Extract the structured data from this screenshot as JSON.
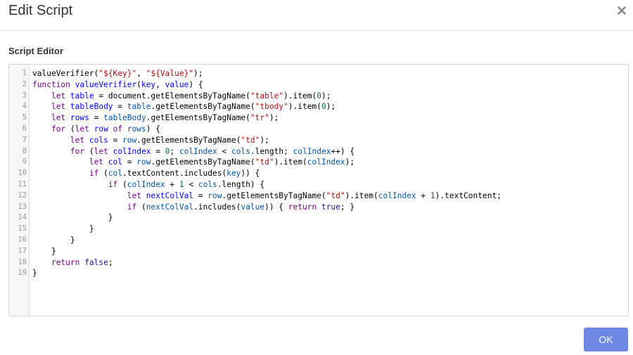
{
  "dialog": {
    "title": "Edit Script",
    "close_icon": "close-icon"
  },
  "editor": {
    "label": "Script Editor",
    "lines": [
      [
        [
          "plain",
          "valueVerifier("
        ],
        [
          "str",
          "\"${Key}\""
        ],
        [
          "plain",
          ", "
        ],
        [
          "str",
          "\"${Value}\""
        ],
        [
          "plain",
          ");"
        ]
      ],
      [
        [
          "kw",
          "function"
        ],
        [
          "plain",
          " "
        ],
        [
          "def",
          "valueVerifier"
        ],
        [
          "plain",
          "("
        ],
        [
          "def",
          "key"
        ],
        [
          "plain",
          ", "
        ],
        [
          "def",
          "value"
        ],
        [
          "plain",
          ") {"
        ]
      ],
      [
        [
          "plain",
          "    "
        ],
        [
          "kw",
          "let"
        ],
        [
          "plain",
          " "
        ],
        [
          "def",
          "table"
        ],
        [
          "plain",
          " = document.getElementsByTagName("
        ],
        [
          "str",
          "\"table\""
        ],
        [
          "plain",
          ").item("
        ],
        [
          "num",
          "0"
        ],
        [
          "plain",
          ");"
        ]
      ],
      [
        [
          "plain",
          "    "
        ],
        [
          "kw",
          "let"
        ],
        [
          "plain",
          " "
        ],
        [
          "def",
          "tableBody"
        ],
        [
          "plain",
          " = "
        ],
        [
          "var2",
          "table"
        ],
        [
          "plain",
          ".getElementsByTagName("
        ],
        [
          "str",
          "\"tbody\""
        ],
        [
          "plain",
          ").item("
        ],
        [
          "num",
          "0"
        ],
        [
          "plain",
          ");"
        ]
      ],
      [
        [
          "plain",
          "    "
        ],
        [
          "kw",
          "let"
        ],
        [
          "plain",
          " "
        ],
        [
          "def",
          "rows"
        ],
        [
          "plain",
          " = "
        ],
        [
          "var2",
          "tableBody"
        ],
        [
          "plain",
          ".getElementsByTagName("
        ],
        [
          "str",
          "\"tr\""
        ],
        [
          "plain",
          ");"
        ]
      ],
      [
        [
          "plain",
          "    "
        ],
        [
          "kw",
          "for"
        ],
        [
          "plain",
          " ("
        ],
        [
          "kw",
          "let"
        ],
        [
          "plain",
          " "
        ],
        [
          "def",
          "row"
        ],
        [
          "plain",
          " "
        ],
        [
          "kw",
          "of"
        ],
        [
          "plain",
          " "
        ],
        [
          "var2",
          "rows"
        ],
        [
          "plain",
          ") {"
        ]
      ],
      [
        [
          "plain",
          "        "
        ],
        [
          "kw",
          "let"
        ],
        [
          "plain",
          " "
        ],
        [
          "def",
          "cols"
        ],
        [
          "plain",
          " = "
        ],
        [
          "var2",
          "row"
        ],
        [
          "plain",
          ".getElementsByTagName("
        ],
        [
          "str",
          "\"td\""
        ],
        [
          "plain",
          ");"
        ]
      ],
      [
        [
          "plain",
          "        "
        ],
        [
          "kw",
          "for"
        ],
        [
          "plain",
          " ("
        ],
        [
          "kw",
          "let"
        ],
        [
          "plain",
          " "
        ],
        [
          "def",
          "colIndex"
        ],
        [
          "plain",
          " = "
        ],
        [
          "num",
          "0"
        ],
        [
          "plain",
          "; "
        ],
        [
          "var2",
          "colIndex"
        ],
        [
          "plain",
          " < "
        ],
        [
          "var2",
          "cols"
        ],
        [
          "plain",
          ".length; "
        ],
        [
          "var2",
          "colIndex"
        ],
        [
          "plain",
          "++) {"
        ]
      ],
      [
        [
          "plain",
          "            "
        ],
        [
          "kw",
          "let"
        ],
        [
          "plain",
          " "
        ],
        [
          "def",
          "col"
        ],
        [
          "plain",
          " = "
        ],
        [
          "var2",
          "row"
        ],
        [
          "plain",
          ".getElementsByTagName("
        ],
        [
          "str",
          "\"td\""
        ],
        [
          "plain",
          ").item("
        ],
        [
          "var2",
          "colIndex"
        ],
        [
          "plain",
          ");"
        ]
      ],
      [
        [
          "plain",
          "            "
        ],
        [
          "kw",
          "if"
        ],
        [
          "plain",
          " ("
        ],
        [
          "var2",
          "col"
        ],
        [
          "plain",
          ".textContent.includes("
        ],
        [
          "var2",
          "key"
        ],
        [
          "plain",
          ")) {"
        ]
      ],
      [
        [
          "plain",
          "                "
        ],
        [
          "kw",
          "if"
        ],
        [
          "plain",
          " ("
        ],
        [
          "var2",
          "colIndex"
        ],
        [
          "plain",
          " + "
        ],
        [
          "num",
          "1"
        ],
        [
          "plain",
          " < "
        ],
        [
          "var2",
          "cols"
        ],
        [
          "plain",
          ".length) {"
        ]
      ],
      [
        [
          "plain",
          "                    "
        ],
        [
          "kw",
          "let"
        ],
        [
          "plain",
          " "
        ],
        [
          "def",
          "nextColVal"
        ],
        [
          "plain",
          " = "
        ],
        [
          "var2",
          "row"
        ],
        [
          "plain",
          ".getElementsByTagName("
        ],
        [
          "str",
          "\"td\""
        ],
        [
          "plain",
          ").item("
        ],
        [
          "var2",
          "colIndex"
        ],
        [
          "plain",
          " + "
        ],
        [
          "num",
          "1"
        ],
        [
          "plain",
          ").textContent;"
        ]
      ],
      [
        [
          "plain",
          "                    "
        ],
        [
          "kw",
          "if"
        ],
        [
          "plain",
          " ("
        ],
        [
          "var2",
          "nextColVal"
        ],
        [
          "plain",
          ".includes("
        ],
        [
          "var2",
          "value"
        ],
        [
          "plain",
          ")) { "
        ],
        [
          "kw",
          "return"
        ],
        [
          "plain",
          " "
        ],
        [
          "atom",
          "true"
        ],
        [
          "plain",
          "; }"
        ]
      ],
      [
        [
          "plain",
          "                }"
        ]
      ],
      [
        [
          "plain",
          "            }"
        ]
      ],
      [
        [
          "plain",
          "        }"
        ]
      ],
      [
        [
          "plain",
          "    }"
        ]
      ],
      [
        [
          "plain",
          "    "
        ],
        [
          "kw",
          "return"
        ],
        [
          "plain",
          " "
        ],
        [
          "atom",
          "false"
        ],
        [
          "plain",
          ";"
        ]
      ],
      [
        [
          "plain",
          "}"
        ]
      ]
    ]
  },
  "footer": {
    "ok_label": "OK"
  },
  "colors": {
    "ok_button": "#6d87e3",
    "keyword": "#770088",
    "definition": "#0000ff",
    "variable": "#0055aa",
    "string": "#aa1111",
    "number": "#116644",
    "atom": "#221199"
  }
}
